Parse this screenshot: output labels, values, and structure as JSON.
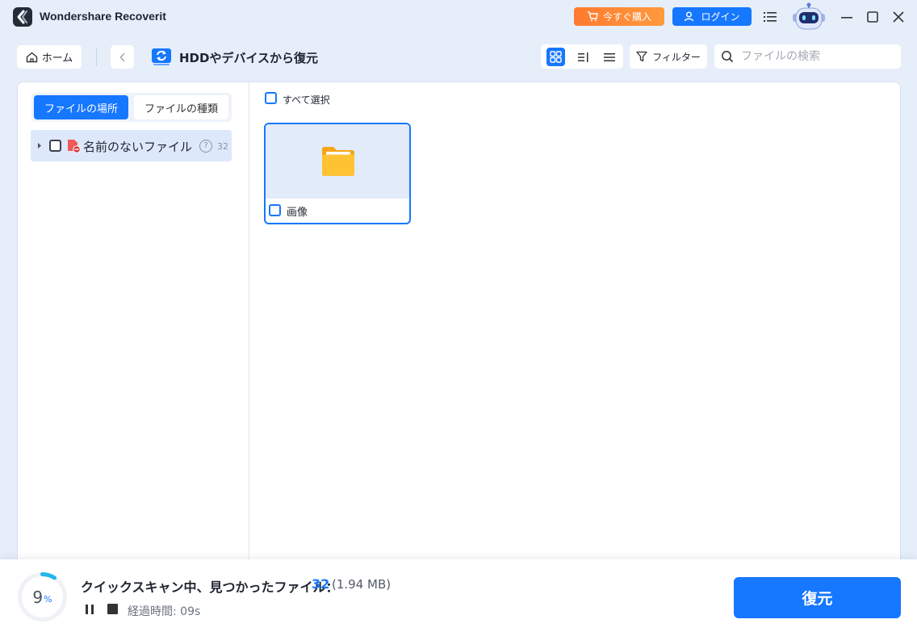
{
  "app": {
    "title": "Wondershare Recoverit",
    "buy_label": "今すぐ購入",
    "login_label": "ログイン"
  },
  "toolbar": {
    "home_label": "ホーム",
    "page_title": "HDDやデバイスから復元",
    "filter_label": "フィルター",
    "search_placeholder": "ファイルの検索"
  },
  "sidebar": {
    "tabs": [
      {
        "label": "ファイルの場所",
        "active": true
      },
      {
        "label": "ファイルの種類",
        "active": false
      }
    ],
    "tree": [
      {
        "label": "名前のないファイル",
        "count": "32",
        "help": "?"
      }
    ]
  },
  "content": {
    "select_all_label": "すべて選択",
    "items": [
      {
        "label": "画像",
        "icon": "folder-icon"
      }
    ]
  },
  "status": {
    "progress_value": "9",
    "progress_unit": "%",
    "progress_fraction": 0.09,
    "scan_text": "クイックスキャン中、見つかったファイル：",
    "found_count": "32",
    "found_size": "(1.94 MB)",
    "elapsed": "経過時間: 09s",
    "recover_label": "復元"
  },
  "colors": {
    "accent": "#1677ff",
    "buy": "#ff7a2f",
    "background": "#e6eefa",
    "selected_row": "#dde8fb"
  }
}
